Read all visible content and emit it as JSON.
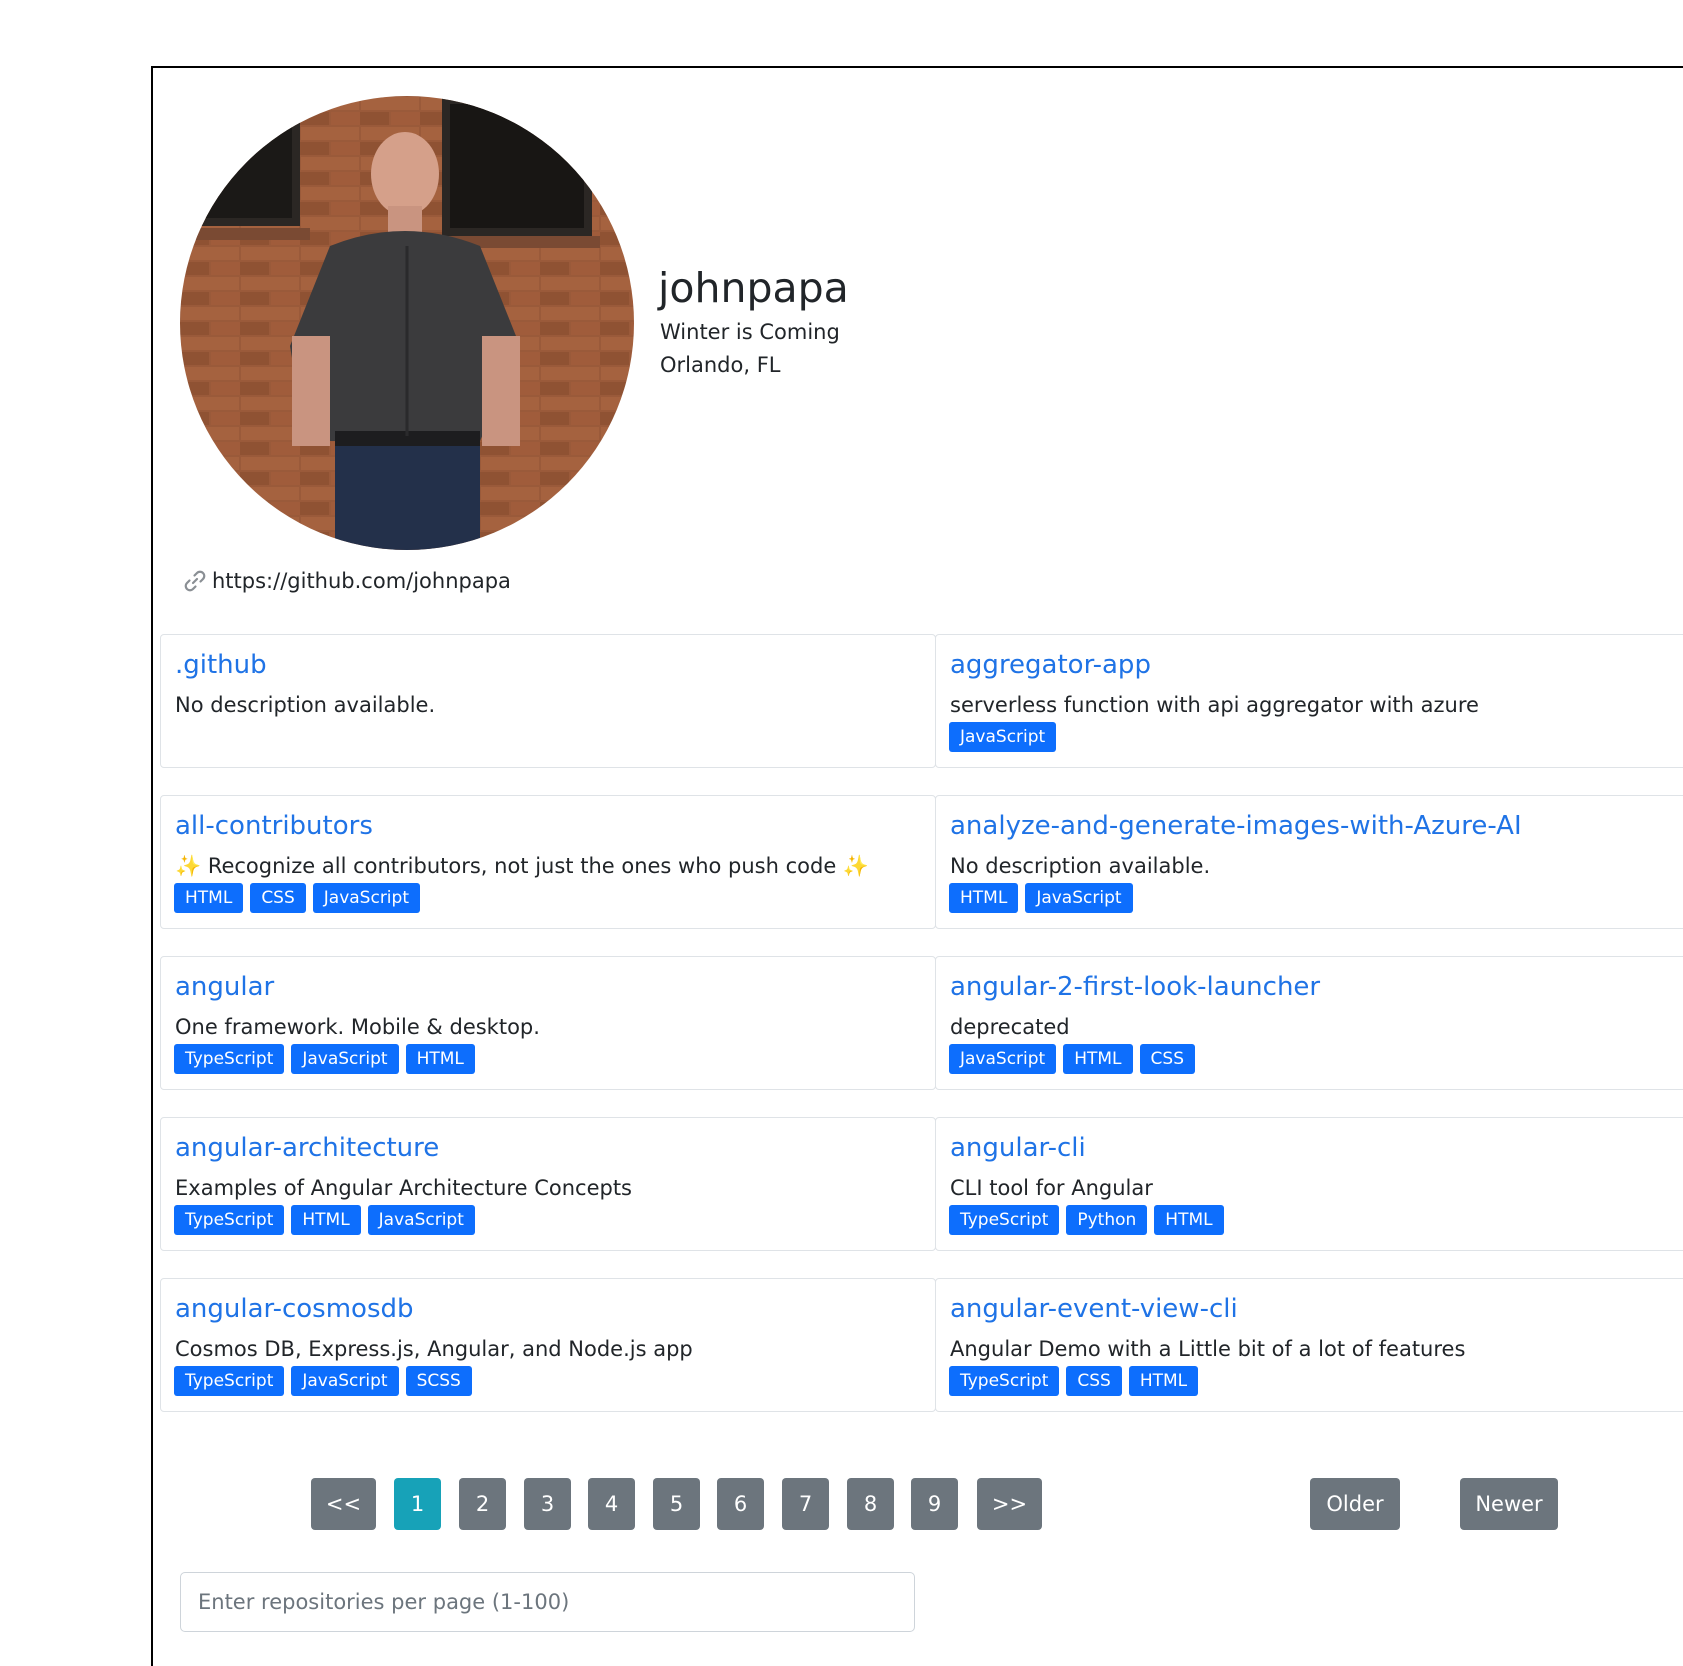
{
  "profile": {
    "username": "johnpapa",
    "bio": "Winter is Coming",
    "location": "Orlando, FL",
    "website": "https://github.com/johnpapa",
    "website_icon": "link-icon",
    "avatar_icon": "profile-photo"
  },
  "repos": [
    {
      "name": ".github",
      "description": "No description available.",
      "languages": []
    },
    {
      "name": "aggregator-app",
      "description": "serverless function with api aggregator with azure",
      "languages": [
        "JavaScript"
      ]
    },
    {
      "name": "all-contributors",
      "description": "✨ Recognize all contributors, not just the ones who push code ✨",
      "languages": [
        "HTML",
        "CSS",
        "JavaScript"
      ]
    },
    {
      "name": "analyze-and-generate-images-with-Azure-AI",
      "description": "No description available.",
      "languages": [
        "HTML",
        "JavaScript"
      ]
    },
    {
      "name": "angular",
      "description": "One framework. Mobile & desktop.",
      "languages": [
        "TypeScript",
        "JavaScript",
        "HTML"
      ]
    },
    {
      "name": "angular-2-first-look-launcher",
      "description": "deprecated",
      "languages": [
        "JavaScript",
        "HTML",
        "CSS"
      ]
    },
    {
      "name": "angular-architecture",
      "description": "Examples of Angular Architecture Concepts",
      "languages": [
        "TypeScript",
        "HTML",
        "JavaScript"
      ]
    },
    {
      "name": "angular-cli",
      "description": "CLI tool for Angular",
      "languages": [
        "TypeScript",
        "Python",
        "HTML"
      ]
    },
    {
      "name": "angular-cosmosdb",
      "description": "Cosmos DB, Express.js, Angular, and Node.js app",
      "languages": [
        "TypeScript",
        "JavaScript",
        "SCSS"
      ]
    },
    {
      "name": "angular-event-view-cli",
      "description": "Angular Demo with a Little bit of a lot of features",
      "languages": [
        "TypeScript",
        "CSS",
        "HTML"
      ]
    }
  ],
  "pagination": {
    "first_label": "<<",
    "last_label": ">>",
    "pages": [
      "1",
      "2",
      "3",
      "4",
      "5",
      "6",
      "7",
      "8",
      "9"
    ],
    "current_page": "1",
    "older_label": "Older",
    "newer_label": "Newer"
  },
  "per_page": {
    "placeholder": "Enter repositories per page (1-100)",
    "value": ""
  },
  "colors": {
    "link": "#1f73e6",
    "badge": "#0d6efd",
    "page_button": "#6c757d",
    "page_active": "#17a2b8"
  }
}
